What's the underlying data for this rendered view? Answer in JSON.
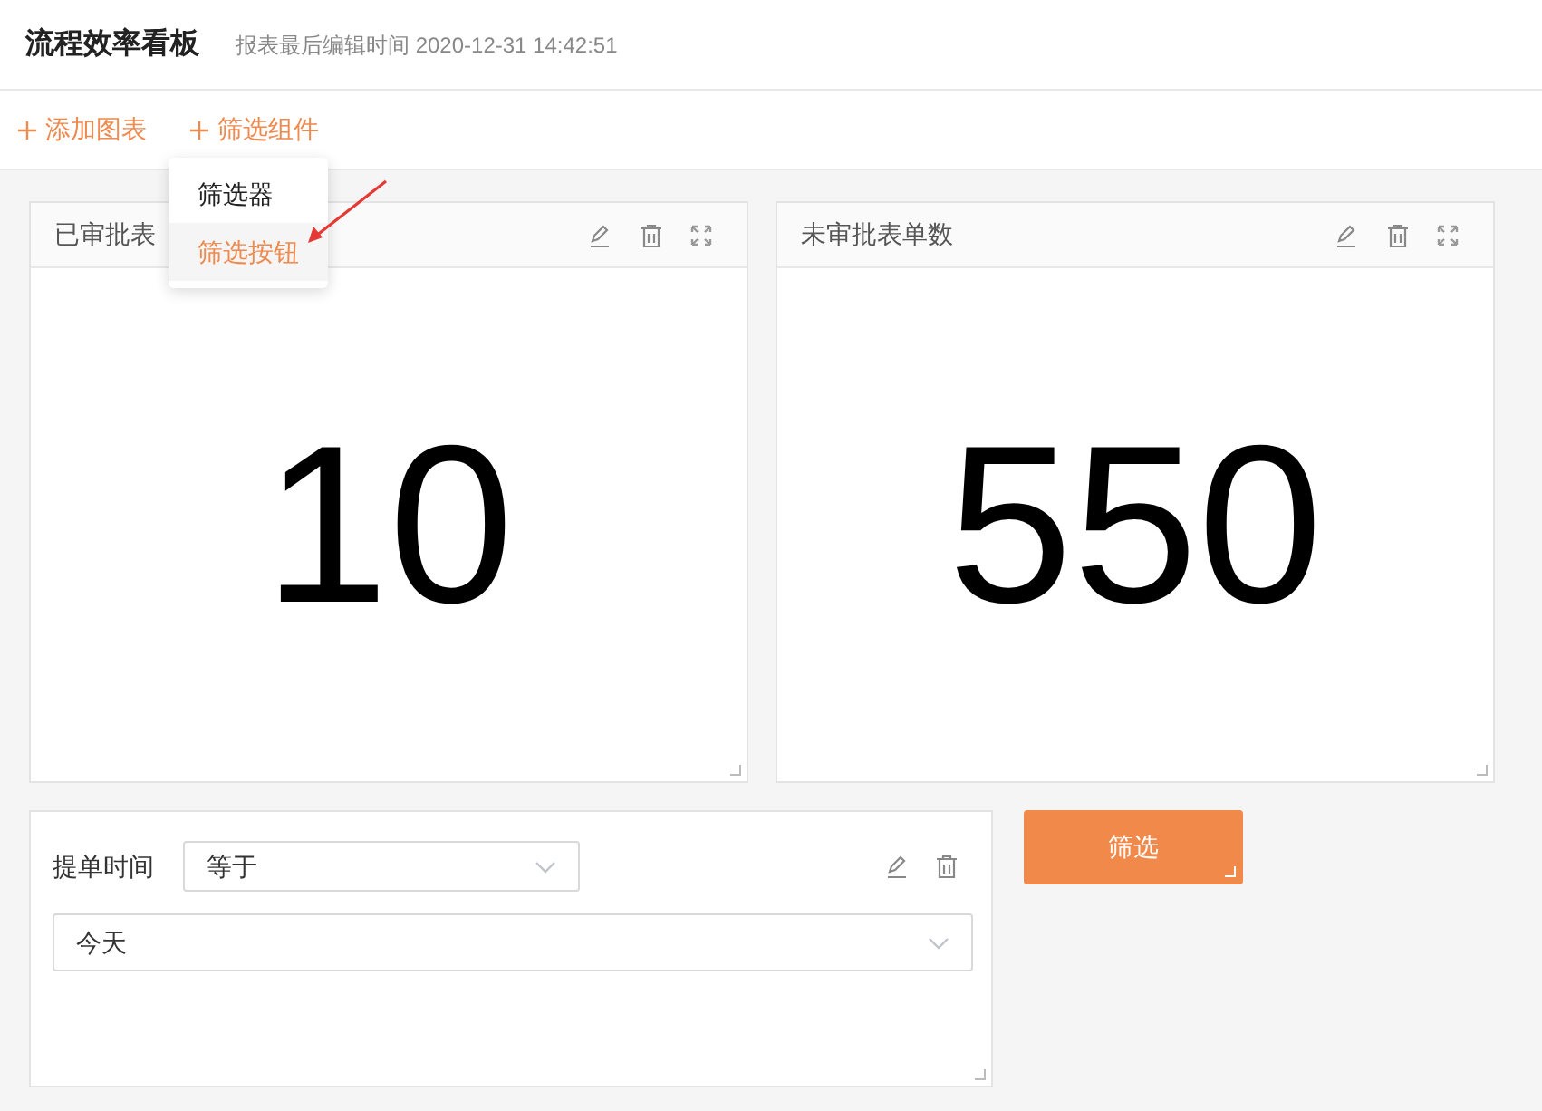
{
  "header": {
    "title": "流程效率看板",
    "subtitle": "报表最后编辑时间 2020-12-31 14:42:51"
  },
  "toolbar": [
    {
      "label": "添加图表"
    },
    {
      "label": "筛选组件"
    }
  ],
  "dropdown_menu": [
    {
      "label": "筛选器",
      "selected": false
    },
    {
      "label": "筛选按钮",
      "selected": true
    }
  ],
  "cards": [
    {
      "title": "已审批表",
      "value": "10"
    },
    {
      "title": "未审批表单数",
      "value": "550"
    }
  ],
  "filter": {
    "label": "提单时间",
    "operator": "等于",
    "value": "今天"
  },
  "filter_button": {
    "label": "筛选"
  }
}
